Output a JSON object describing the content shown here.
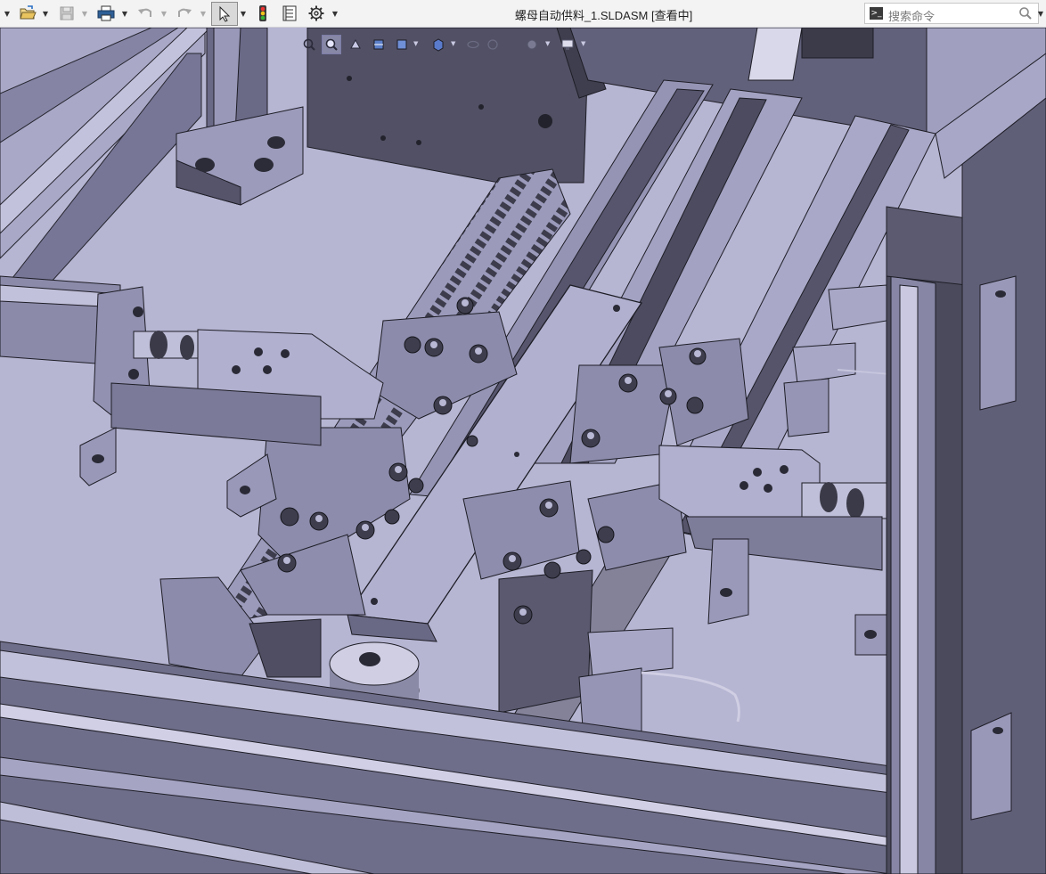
{
  "window": {
    "title": "螺母自动供料_1.SLDASM [查看中]"
  },
  "toolbar": {
    "icons": [
      "menu-arrow-icon",
      "open-folder-icon",
      "save-icon",
      "print-icon",
      "undo-icon",
      "redo-icon",
      "select-pointer-icon",
      "rebuild-traffic-light-icon",
      "file-properties-icon",
      "options-gear-icon"
    ]
  },
  "search": {
    "placeholder": "搜索命令"
  },
  "heads_up_toolbar": {
    "icons": [
      "zoom-to-fit-icon",
      "zoom-area-icon",
      "previous-view-icon",
      "section-view-icon",
      "view-orientation-icon",
      "display-style-icon",
      "hide-show-icon",
      "edit-appearance-icon",
      "apply-scene-icon",
      "view-settings-icon"
    ]
  },
  "colors": {
    "toolbar_bg": "#f3f3f3",
    "model_face_light": "#b7b6d3",
    "model_face_mid": "#8f8eae",
    "model_face_dark": "#4a4a5c",
    "model_edge": "#1d1d26"
  },
  "viewport": {
    "content": "3D assembly model view"
  }
}
